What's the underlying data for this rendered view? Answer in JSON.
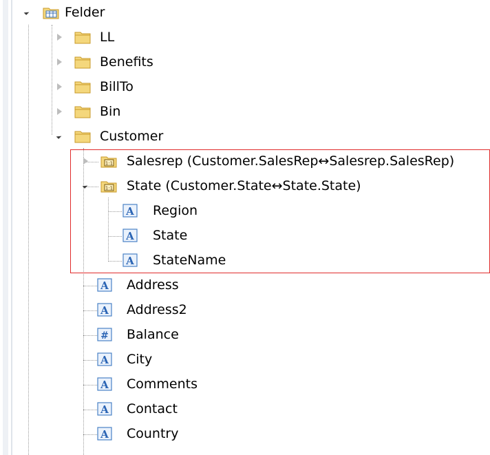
{
  "tree": {
    "root": {
      "label": "Felder",
      "icon": "table-folder-icon"
    },
    "folders": [
      {
        "label": "LL"
      },
      {
        "label": "Benefits"
      },
      {
        "label": "BillTo"
      },
      {
        "label": "Bin"
      },
      {
        "label": "Customer"
      }
    ],
    "relations": [
      {
        "label": "Salesrep (Customer.SalesRep↔Salesrep.SalesRep)"
      },
      {
        "label": "State (Customer.State↔State.State)"
      }
    ],
    "state_fields": [
      {
        "label": "Region",
        "type": "A"
      },
      {
        "label": "State",
        "type": "A"
      },
      {
        "label": "StateName",
        "type": "A"
      }
    ],
    "customer_fields": [
      {
        "label": "Address",
        "type": "A"
      },
      {
        "label": "Address2",
        "type": "A"
      },
      {
        "label": "Balance",
        "type": "#"
      },
      {
        "label": "City",
        "type": "A"
      },
      {
        "label": "Comments",
        "type": "A"
      },
      {
        "label": "Contact",
        "type": "A"
      },
      {
        "label": "Country",
        "type": "A"
      }
    ]
  },
  "colors": {
    "folder_fill": "#f4d77c",
    "folder_border": "#c79a2a",
    "field_icon_border": "#4a82c6",
    "field_icon_text": "#2a64b4",
    "highlight_border": "#e02a2a"
  }
}
